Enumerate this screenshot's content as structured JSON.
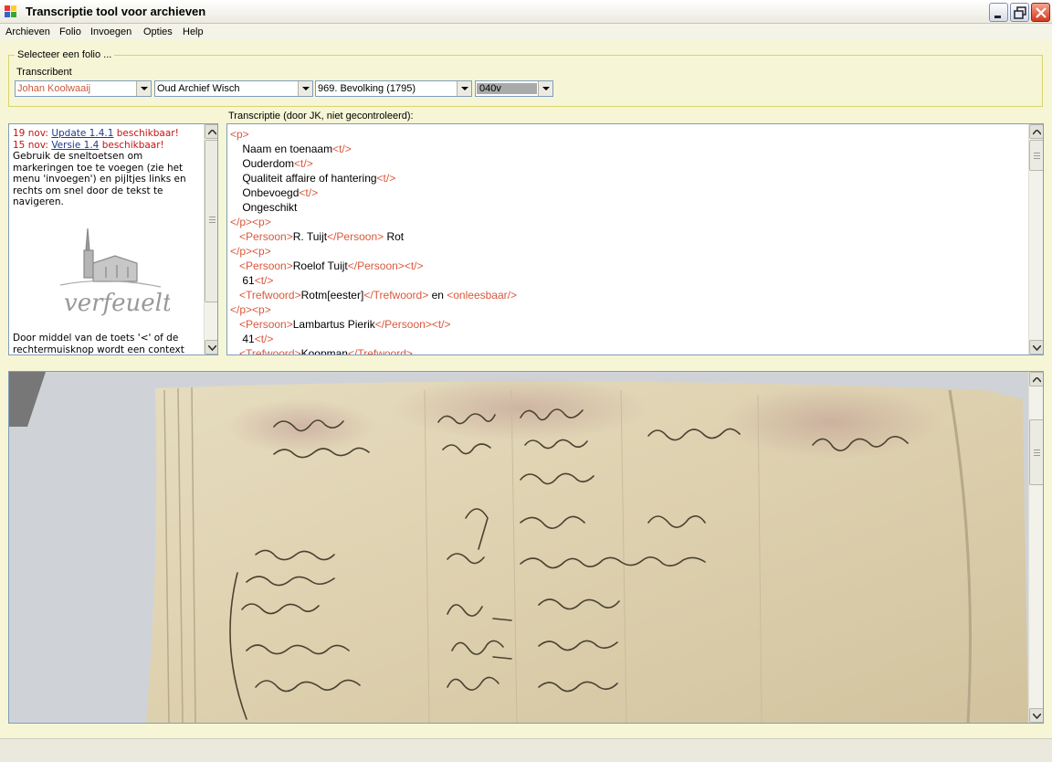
{
  "window": {
    "title": "Transcriptie tool voor archieven"
  },
  "menu": {
    "items": [
      "Archieven",
      "Folio",
      "Invoegen",
      "Opties",
      "Help"
    ]
  },
  "selection": {
    "group_caption": "Selecteer een folio ...",
    "transcribent_label": "Transcribent",
    "transcribent": "Johan Koolwaaij",
    "archive": "Oud Archief Wisch",
    "inventory": "969. Bevolking (1795)",
    "folio": "040v"
  },
  "info": {
    "news": [
      {
        "date": "19 nov:",
        "link": "Update 1.4.1",
        "suffix": "beschikbaar!"
      },
      {
        "date": "15 nov:",
        "link": "Versie 1.4",
        "suffix": "beschikbaar!"
      }
    ],
    "help_text": "Gebruik de sneltoetsen om markeringen toe te voegen (zie het menu 'invoegen') en pijltjes links en rechts om snel door de tekst te navigeren.",
    "logo_text": "verfeuelt",
    "help_text_2": "Door middel van de toets '<' of de rechtermuisknop wordt een context"
  },
  "transcript": {
    "label": "Transcriptie (door JK, niet gecontroleerd):",
    "lines": [
      [
        {
          "t": "tag",
          "v": "<p>"
        }
      ],
      [
        {
          "t": "txt",
          "v": "    Naam en toenaam"
        },
        {
          "t": "tag",
          "v": "<t/>"
        }
      ],
      [
        {
          "t": "txt",
          "v": "    Ouderdom"
        },
        {
          "t": "tag",
          "v": "<t/>"
        }
      ],
      [
        {
          "t": "txt",
          "v": "    Qualiteit affaire of hantering"
        },
        {
          "t": "tag",
          "v": "<t/>"
        }
      ],
      [
        {
          "t": "txt",
          "v": "    Onbevoegd"
        },
        {
          "t": "tag",
          "v": "<t/>"
        }
      ],
      [
        {
          "t": "txt",
          "v": "    Ongeschikt"
        }
      ],
      [
        {
          "t": "tag",
          "v": "</p><p>"
        }
      ],
      [
        {
          "t": "txt",
          "v": "   "
        },
        {
          "t": "tag",
          "v": "<Persoon>"
        },
        {
          "t": "txt",
          "v": "R. Tuijt"
        },
        {
          "t": "tag",
          "v": "</Persoon>"
        },
        {
          "t": "txt",
          "v": " Rot"
        }
      ],
      [
        {
          "t": "tag",
          "v": "</p><p>"
        }
      ],
      [
        {
          "t": "txt",
          "v": "   "
        },
        {
          "t": "tag",
          "v": "<Persoon>"
        },
        {
          "t": "txt",
          "v": "Roelof Tuijt"
        },
        {
          "t": "tag",
          "v": "</Persoon><t/>"
        }
      ],
      [
        {
          "t": "txt",
          "v": "    61"
        },
        {
          "t": "tag",
          "v": "<t/>"
        }
      ],
      [
        {
          "t": "txt",
          "v": "   "
        },
        {
          "t": "tag",
          "v": "<Trefwoord>"
        },
        {
          "t": "txt",
          "v": "Rotm[eester]"
        },
        {
          "t": "tag",
          "v": "</Trefwoord>"
        },
        {
          "t": "txt",
          "v": " en "
        },
        {
          "t": "tag",
          "v": "<onleesbaar/>"
        }
      ],
      [
        {
          "t": "tag",
          "v": "</p><p>"
        }
      ],
      [
        {
          "t": "txt",
          "v": "   "
        },
        {
          "t": "tag",
          "v": "<Persoon>"
        },
        {
          "t": "txt",
          "v": "Lambartus Pierik"
        },
        {
          "t": "tag",
          "v": "</Persoon><t/>"
        }
      ],
      [
        {
          "t": "txt",
          "v": "    41"
        },
        {
          "t": "tag",
          "v": "<t/>"
        }
      ],
      [
        {
          "t": "txt",
          "v": "   "
        },
        {
          "t": "tag",
          "v": "<Trefwoord>"
        },
        {
          "t": "txt",
          "v": "Koopman"
        },
        {
          "t": "tag",
          "v": "</Trefwoord>"
        }
      ]
    ]
  },
  "colors": {
    "tag": "#d9583d",
    "news": "#cc1111",
    "background": "#f6f6d6"
  }
}
